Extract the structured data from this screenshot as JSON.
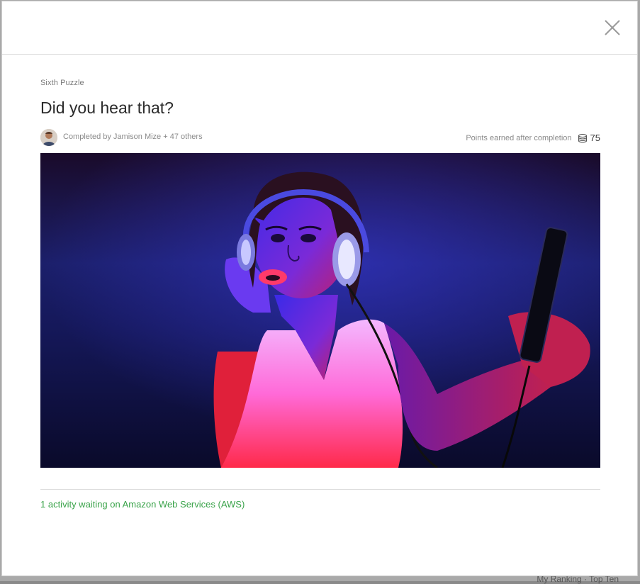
{
  "modal": {
    "eyebrow": "Sixth Puzzle",
    "title": "Did you hear that?",
    "completed_by": "Completed by Jamison Mize + 47 others",
    "points_label": "Points earned after completion",
    "points_value": "75",
    "points_icon": "coins-icon",
    "close_icon": "close-icon",
    "activity_link": "1 activity waiting on Amazon Web Services (AWS)"
  },
  "background": {
    "footer_text": "My Ranking · Top Ten"
  },
  "colors": {
    "accent_green": "#3aa34a",
    "image_blue": "#2a22d8",
    "image_pink": "#ff2a6a"
  }
}
